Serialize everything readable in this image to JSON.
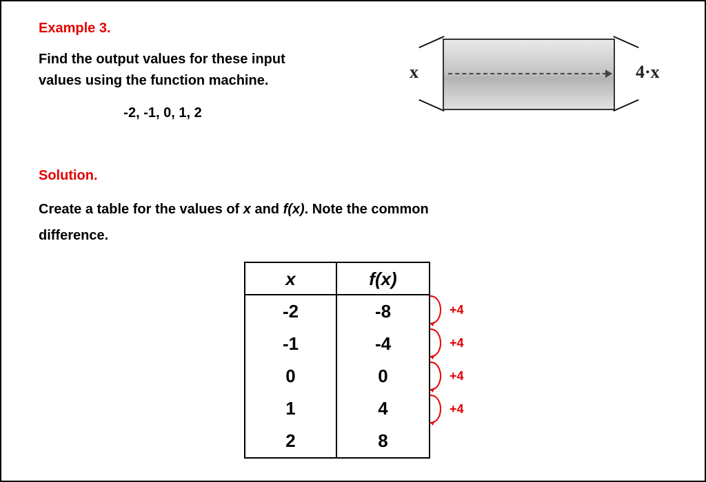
{
  "example_heading": "Example 3.",
  "prompt": "Find the output values for these input values using the function machine.",
  "input_list": "-2, -1, 0, 1, 2",
  "machine": {
    "input_label": "x",
    "output_label": "4·x"
  },
  "solution_heading": "Solution.",
  "solution_text_pre": "Create a table for the values of ",
  "solution_x": "x",
  "solution_mid": " and ",
  "solution_fx": "f(x)",
  "solution_post": ". Note the common difference.",
  "table": {
    "header_x": "x",
    "header_fx": "f(x)",
    "rows": [
      {
        "x": "-2",
        "fx": "-8"
      },
      {
        "x": "-1",
        "fx": "-4"
      },
      {
        "x": "0",
        "fx": "0"
      },
      {
        "x": "1",
        "fx": "4"
      },
      {
        "x": "2",
        "fx": "8"
      }
    ]
  },
  "common_difference": "+4",
  "colors": {
    "accent": "#e40000"
  },
  "chart_data": {
    "type": "table",
    "title": "Function machine f(x) = 4·x",
    "columns": [
      "x",
      "f(x)"
    ],
    "rows": [
      [
        -2,
        -8
      ],
      [
        -1,
        -4
      ],
      [
        0,
        0
      ],
      [
        1,
        4
      ],
      [
        2,
        8
      ]
    ],
    "common_difference": 4
  }
}
